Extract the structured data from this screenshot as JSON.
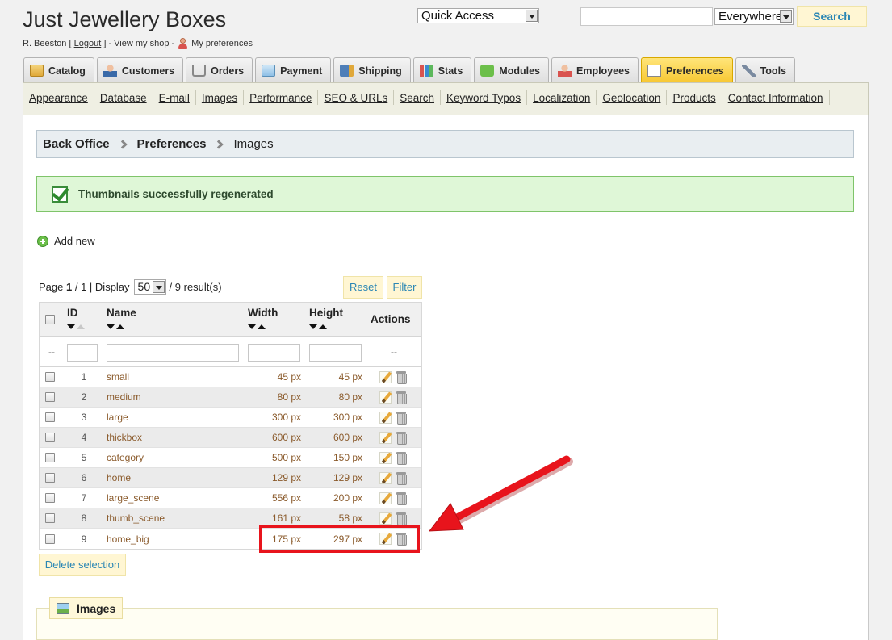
{
  "header": {
    "shop_name": "Just Jewellery Boxes",
    "user_name": "R. Beeston [",
    "logout": "Logout",
    "view_shop": "] - View my shop -",
    "my_preferences": "My preferences",
    "quick_access": "Quick Access",
    "search_scope": "Everywhere",
    "search_button": "Search",
    "search_value": ""
  },
  "tabs": [
    {
      "label": "Catalog",
      "icon": "folder-icon"
    },
    {
      "label": "Customers",
      "icon": "customer-icon"
    },
    {
      "label": "Orders",
      "icon": "cart-icon"
    },
    {
      "label": "Payment",
      "icon": "payment-icon"
    },
    {
      "label": "Shipping",
      "icon": "truck-icon"
    },
    {
      "label": "Stats",
      "icon": "chart-icon"
    },
    {
      "label": "Modules",
      "icon": "puzzle-icon"
    },
    {
      "label": "Employees",
      "icon": "employee-icon"
    },
    {
      "label": "Preferences",
      "icon": "preferences-icon",
      "active": true
    },
    {
      "label": "Tools",
      "icon": "wrench-icon"
    }
  ],
  "subnav": [
    "Appearance",
    "Database",
    "E-mail",
    "Images",
    "Performance",
    "SEO & URLs",
    "Search",
    "Keyword Typos",
    "Localization",
    "Geolocation",
    "Products",
    "Contact Information"
  ],
  "breadcrumb": [
    "Back Office",
    "Preferences",
    "Images"
  ],
  "success_message": "Thumbnails successfully regenerated",
  "add_new": "Add new",
  "pager": {
    "page_label": "Page",
    "page": "1",
    "of": "/ 1 | Display",
    "per_page": "50",
    "results": "/ 9 result(s)"
  },
  "buttons": {
    "reset": "Reset",
    "filter": "Filter",
    "delete_selection": "Delete selection"
  },
  "table": {
    "columns": [
      "ID",
      "Name",
      "Width",
      "Height",
      "Actions"
    ],
    "filter_placeholder": "--",
    "rows": [
      {
        "id": "1",
        "name": "small",
        "width": "45 px",
        "height": "45 px"
      },
      {
        "id": "2",
        "name": "medium",
        "width": "80 px",
        "height": "80 px"
      },
      {
        "id": "3",
        "name": "large",
        "width": "300 px",
        "height": "300 px"
      },
      {
        "id": "4",
        "name": "thickbox",
        "width": "600 px",
        "height": "600 px"
      },
      {
        "id": "5",
        "name": "category",
        "width": "500 px",
        "height": "150 px"
      },
      {
        "id": "6",
        "name": "home",
        "width": "129 px",
        "height": "129 px"
      },
      {
        "id": "7",
        "name": "large_scene",
        "width": "556 px",
        "height": "200 px"
      },
      {
        "id": "8",
        "name": "thumb_scene",
        "width": "161 px",
        "height": "58 px"
      },
      {
        "id": "9",
        "name": "home_big",
        "width": "175 px",
        "height": "297 px"
      }
    ]
  },
  "section_legend": "Images",
  "colors": {
    "annotation": "#e8141c",
    "active_tab": "#f7c731",
    "link": "#2a86b4"
  }
}
